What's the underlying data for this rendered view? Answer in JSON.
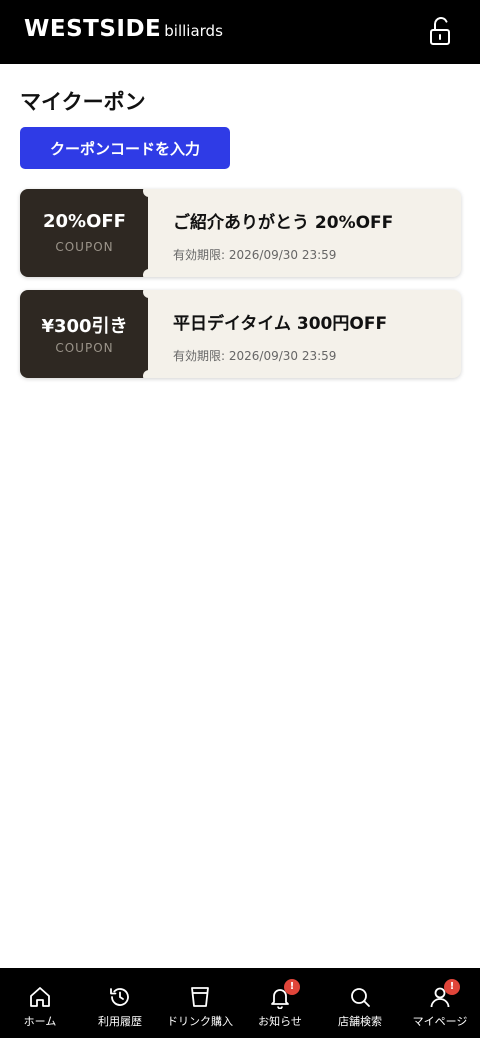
{
  "header": {
    "logo_main": "WESTSIDE",
    "logo_sub": "billiards",
    "lock_icon": "unlock-icon"
  },
  "page": {
    "title": "マイクーポン",
    "code_button_label": "クーポンコードを入力"
  },
  "coupons": [
    {
      "badge": "20%OFF",
      "label": "COUPON",
      "title": "ご紹介ありがとう 20%OFF",
      "expiry": "有効期限: 2026/09/30 23:59"
    },
    {
      "badge": "¥300引き",
      "label": "COUPON",
      "title": "平日デイタイム 300円OFF",
      "expiry": "有効期限: 2026/09/30 23:59"
    }
  ],
  "bottom_nav": [
    {
      "label": "ホーム",
      "icon": "home-icon"
    },
    {
      "label": "利用履歴",
      "icon": "history-icon"
    },
    {
      "label": "ドリンク購入",
      "icon": "drink-cup-icon"
    },
    {
      "label": "お知らせ",
      "icon": "bell-icon",
      "badge": "!"
    },
    {
      "label": "店舗検索",
      "icon": "search-icon"
    },
    {
      "label": "マイページ",
      "icon": "user-icon",
      "badge": "!"
    }
  ],
  "colors": {
    "header_bg": "#000000",
    "button_bg": "#2f3be6",
    "coupon_left_bg": "#2e2822",
    "coupon_right_bg": "#f4f1ea",
    "badge_red": "#e0453a"
  }
}
